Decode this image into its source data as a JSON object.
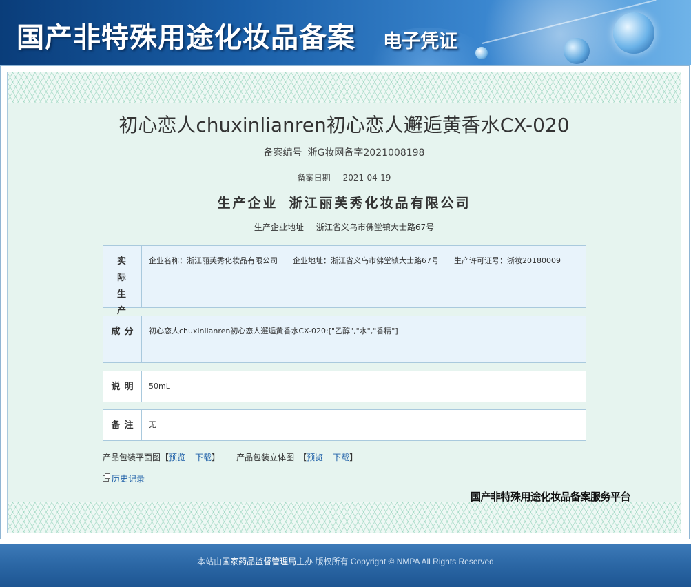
{
  "header": {
    "title": "国产非特殊用途化妆品备案",
    "subtitle": "电子凭证"
  },
  "certificate": {
    "product_name": "初心恋人chuxinlianren初心恋人邂逅黄香水CX-020",
    "filing_no_label": "备案编号",
    "filing_no": "浙G妆网备字2021008198",
    "filing_date_label": "备案日期",
    "filing_date": "2021-04-19",
    "manufacturer_label": "生产企业",
    "manufacturer": "浙江丽芙秀化妆品有限公司",
    "manufacturer_address_label": "生产企业地址",
    "manufacturer_address": "浙江省义乌市佛堂镇大士路67号"
  },
  "sections": {
    "actual_producer": {
      "label": "实际生产企业",
      "company_name": "企业名称：浙江丽芙秀化妆品有限公司",
      "company_address": "企业地址：浙江省义乌市佛堂镇大士路67号",
      "license": "生产许可证号：浙妆20180009"
    },
    "ingredients": {
      "label": "成分",
      "value": "初心恋人chuxinlianren初心恋人邂逅黄香水CX-020:[\"乙醇\",\"水\",\"香精\"]"
    },
    "description": {
      "label": "说明",
      "value": "50mL"
    },
    "remarks": {
      "label": "备注",
      "value": "无"
    }
  },
  "links": {
    "flat_label": "产品包装平面图",
    "stereo_label": "产品包装立体图",
    "preview": "预览",
    "download": "下载",
    "bracket_open": "【",
    "bracket_close": "】",
    "history": "历史记录"
  },
  "platform_name": "国产非特殊用途化妆品备案服务平台",
  "footer": {
    "prefix": "本站由",
    "org": "国家药品监督管理局",
    "suffix": "主办 版权所有 Copyright © NMPA All Rights Reserved"
  }
}
